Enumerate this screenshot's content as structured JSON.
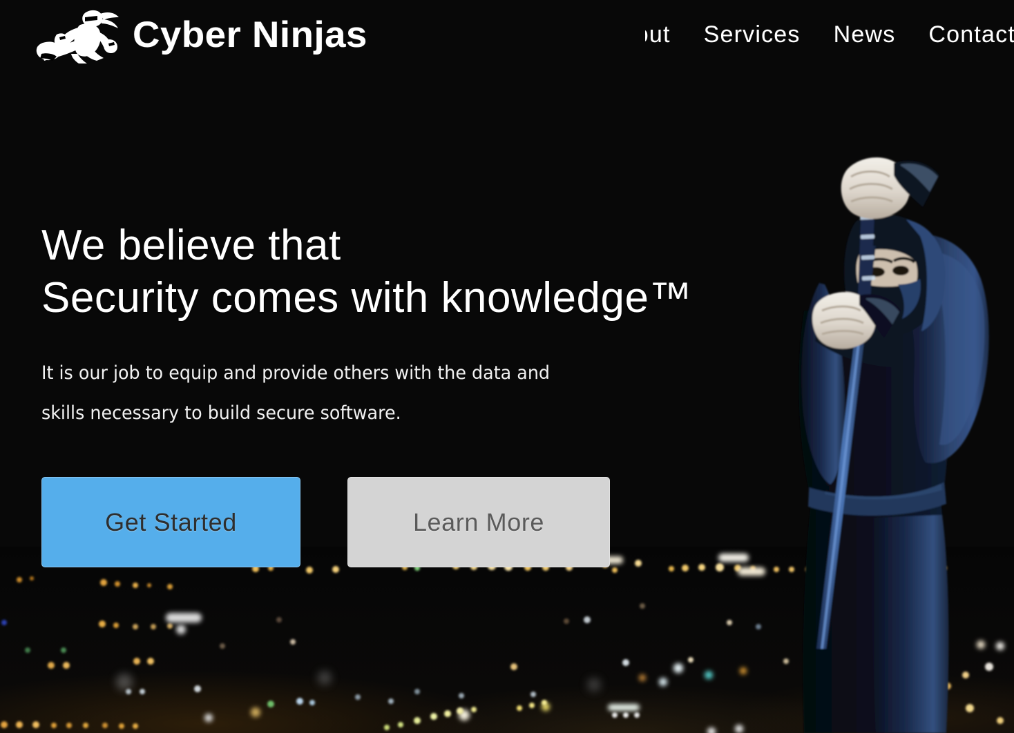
{
  "site": {
    "brand_name": "Cyber Ninjas",
    "logo_icon": "ninja-flying-kick-icon"
  },
  "nav": {
    "items": [
      {
        "label": "About"
      },
      {
        "label": "Services"
      },
      {
        "label": "News"
      },
      {
        "label": "Contact"
      }
    ]
  },
  "hero": {
    "headline": "We believe that\nSecurity comes with knowledge™",
    "subtitle": "It is our job to equip and provide others with the data and\nskills necessary to build secure software.",
    "primary_button": "Get Started",
    "secondary_button": "Learn More"
  },
  "colors": {
    "background": "#070707",
    "primary_button_bg": "#55AEEB",
    "primary_button_text": "#2e2e2e",
    "secondary_button_bg": "#D4D4D4",
    "secondary_button_text": "#5a5a5a",
    "brand_text": "#ffffff",
    "nav_text": "#ffffff",
    "ninja_garb": "#2b3f6b"
  }
}
